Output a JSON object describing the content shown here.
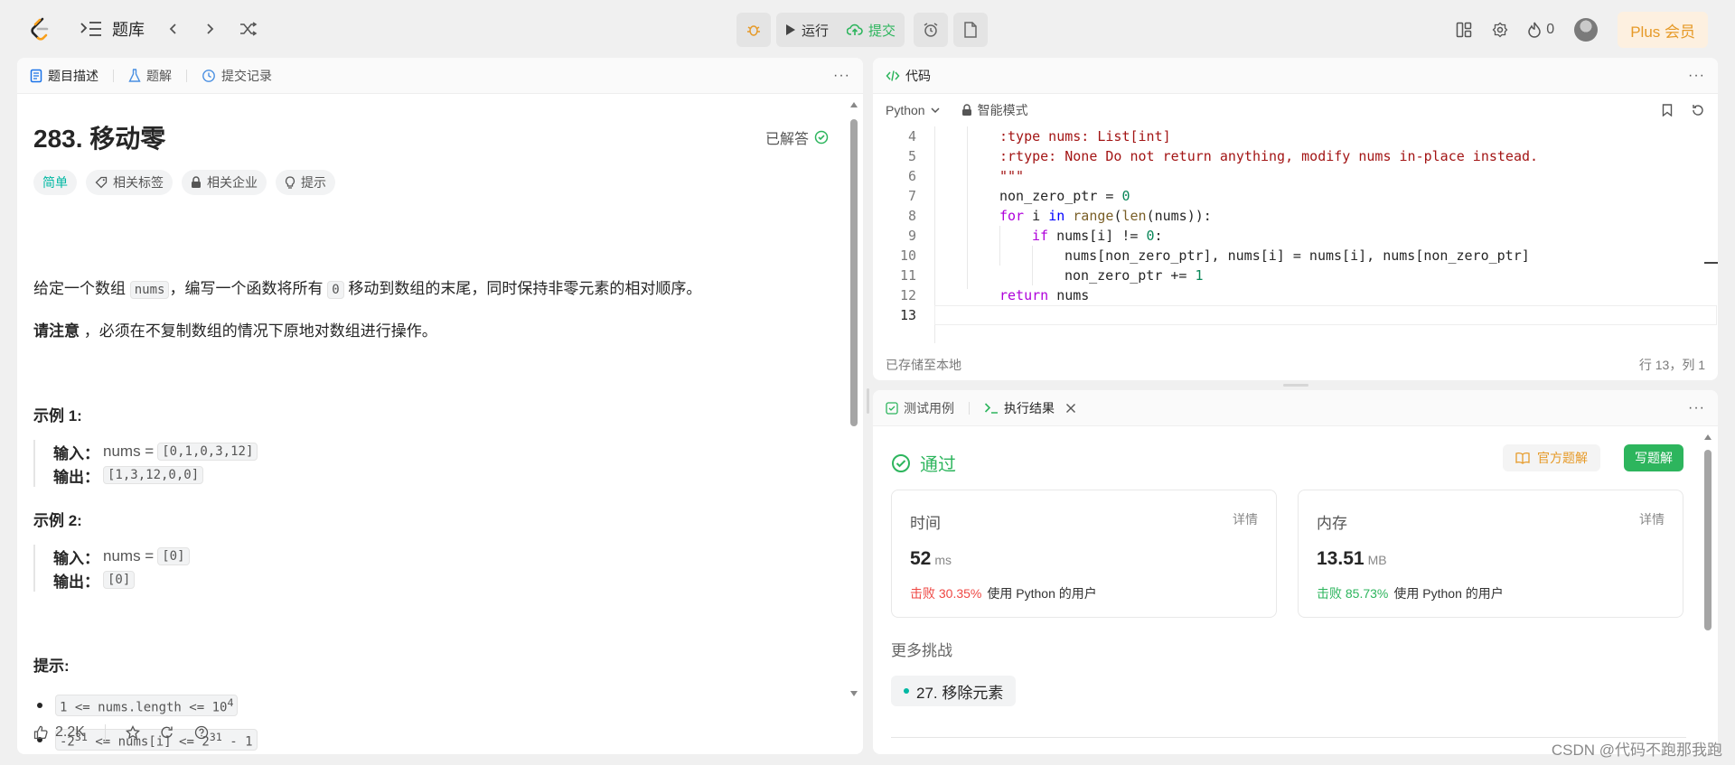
{
  "topbar": {
    "library_label": "题库",
    "run_label": "运行",
    "submit_label": "提交",
    "fire_count": "0",
    "plus_label": "Plus 会员"
  },
  "left": {
    "tabs": [
      "题目描述",
      "题解",
      "提交记录"
    ],
    "title": "283. 移动零",
    "solved_label": "已解答",
    "tags": [
      "简单",
      "相关标签",
      "相关企业",
      "提示"
    ],
    "desc_before": "给定一个数组 ",
    "desc_code1": "nums",
    "desc_mid": "，编写一个函数将所有 ",
    "desc_code2": "0",
    "desc_after": " 移动到数组的末尾，同时保持非零元素的相对顺序。",
    "note_bold": "请注意",
    "note_text": " ，必须在不复制数组的情况下原地对数组进行操作。",
    "examples": [
      {
        "heading": "示例 1:",
        "input_label": "输入：",
        "input_var": "nums = ",
        "input_val": "[0,1,0,3,12]",
        "output_label": "输出：",
        "output_val": "[1,3,12,0,0]"
      },
      {
        "heading": "示例 2:",
        "input_label": "输入：",
        "input_var": "nums = ",
        "input_val": "[0]",
        "output_label": "输出：",
        "output_val": "[0]"
      }
    ],
    "hints_heading": "提示:",
    "hint1": "1 <= nums.length <= 10",
    "hint1_sup": "4",
    "hint2_a": "-2",
    "hint2_sup1": "31",
    "hint2_b": " <= nums[i] <= 2",
    "hint2_sup2": "31",
    "hint2_c": " - 1",
    "likes": "2.2K"
  },
  "code": {
    "tab": "代码",
    "language": "Python",
    "mode": "智能模式",
    "lines": [
      {
        "n": "4",
        "text": ":type nums: List[int]"
      },
      {
        "n": "5",
        "text": ":rtype: None Do not return anything, modify nums in-place instead."
      },
      {
        "n": "6",
        "text": "\"\"\""
      },
      {
        "n": "7",
        "text": "non_zero_ptr = 0"
      },
      {
        "n": "8",
        "text": "for i in range(len(nums)):"
      },
      {
        "n": "9",
        "text": "if nums[i] != 0:"
      },
      {
        "n": "10",
        "text": "nums[non_zero_ptr], nums[i] = nums[i], nums[non_zero_ptr]"
      },
      {
        "n": "11",
        "text": "non_zero_ptr += 1"
      },
      {
        "n": "12",
        "text": "return nums"
      },
      {
        "n": "13",
        "text": ""
      }
    ],
    "saved": "已存储至本地",
    "position": "行 13，列 1"
  },
  "result": {
    "tabs": [
      "测试用例",
      "执行结果"
    ],
    "status": "通过",
    "official_btn": "官方题解",
    "write_btn": "写题解",
    "time": {
      "label": "时间",
      "detail": "详情",
      "value": "52",
      "unit": "ms",
      "beat_pct": "击败 30.35%",
      "beat_text": "使用 Python 的用户"
    },
    "memory": {
      "label": "内存",
      "detail": "详情",
      "value": "13.51",
      "unit": "MB",
      "beat_pct": "击败 85.73%",
      "beat_text": "使用 Python 的用户"
    },
    "more_label": "更多挑战",
    "challenge": "27. 移除元素"
  },
  "watermark": "CSDN @代码不跑那我跑"
}
